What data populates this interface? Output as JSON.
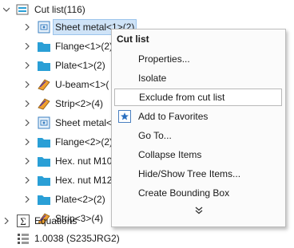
{
  "tree": {
    "items": [
      {
        "label": "Cut list(116)",
        "icon": "cut-list-icon",
        "expanded": true
      },
      {
        "label": "Sheet metal<1>(2)",
        "icon": "sheet-metal-icon",
        "selected": true
      },
      {
        "label": "Flange<1>(2)",
        "icon": "folder-icon"
      },
      {
        "label": "Plate<1>(2)",
        "icon": "folder-icon"
      },
      {
        "label": "U-beam<1>(",
        "icon": "structural-member-icon"
      },
      {
        "label": "Strip<2>(4)",
        "icon": "structural-member-icon"
      },
      {
        "label": "Sheet metal<",
        "icon": "sheet-metal-icon"
      },
      {
        "label": "Flange<2>(2)",
        "icon": "folder-icon"
      },
      {
        "label": "Hex. nut M10",
        "icon": "folder-icon"
      },
      {
        "label": "Hex. nut M12",
        "icon": "folder-icon"
      },
      {
        "label": "Plate<2>(2)",
        "icon": "folder-icon"
      },
      {
        "label": "Strip<3>(4)",
        "icon": "structural-member-icon"
      },
      {
        "label": "Equations",
        "icon": "equations-icon"
      },
      {
        "label": "1.0038 (S235JRG2)",
        "icon": "material-icon"
      }
    ]
  },
  "menu": {
    "title": "Cut list",
    "items": [
      {
        "label": "Properties...",
        "hot": false
      },
      {
        "label": "Isolate",
        "hot": false
      },
      {
        "label": "Exclude from cut list",
        "hot": true
      },
      {
        "label": "Add to Favorites",
        "hot": false,
        "icon": "favorites-star-icon"
      },
      {
        "label": "Go To...",
        "hot": false
      },
      {
        "label": "Collapse Items",
        "hot": false
      },
      {
        "label": "Hide/Show Tree Items...",
        "hot": false
      },
      {
        "label": "Create Bounding Box",
        "hot": false
      }
    ],
    "more_glyph": "⌄"
  },
  "colors": {
    "folder": "#2a9fd6",
    "selection": "#cfe3f7",
    "menu_bg": "#fbfbfb"
  }
}
